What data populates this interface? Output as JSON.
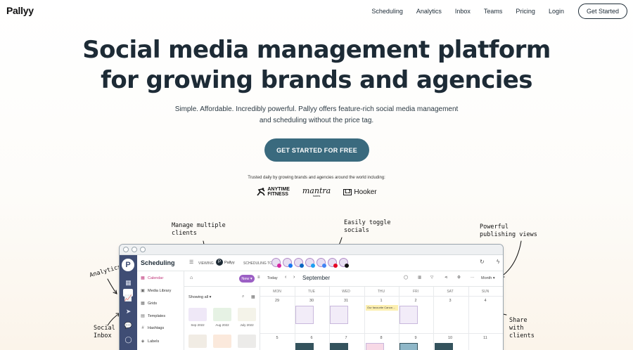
{
  "nav": {
    "logo": "Pallyy",
    "links": [
      "Scheduling",
      "Analytics",
      "Inbox",
      "Teams",
      "Pricing",
      "Login"
    ],
    "cta": "Get Started"
  },
  "hero": {
    "title_line1": "Social media management platform",
    "title_line2": "for growing brands and agencies",
    "subtitle_line1": "Simple. Affordable. Incredibly powerful. Pallyy offers feature-rich social media management",
    "subtitle_line2": "and scheduling without the price tag.",
    "cta": "GET STARTED FOR FREE"
  },
  "trusted": {
    "text": "Trusted daily by growing brands and agencies around the world including:",
    "brands": {
      "anytime_line1": "ANYTIME",
      "anytime_line2": "FITNESS",
      "mantra": "mantra",
      "mantra_sub": "hotels",
      "ljbox": "LJ",
      "lj": "Hooker"
    }
  },
  "annotations": {
    "manage_line1": "Manage multiple",
    "manage_line2": "clients",
    "toggle_line1": "Easily toggle",
    "toggle_line2": "socials",
    "views_line1": "Powerful",
    "views_line2": "publishing views",
    "analytics": "Analytics",
    "inbox_line1": "Social",
    "inbox_line2": "Inbox",
    "share_line1": "Share",
    "share_line2": "with",
    "share_line3": "clients"
  },
  "app": {
    "title": "Scheduling",
    "viewing": "VIEWING",
    "client": "Pallyy",
    "scheduling_to": "SCHEDULING TO",
    "sidebar": [
      "Calendar",
      "Media Library",
      "Grids",
      "Templates",
      "Hashtags",
      "Labels"
    ],
    "new_button": "New",
    "today": "Today",
    "month_name": "September",
    "view_select": "Month",
    "showing": "Showing all",
    "folders": [
      "Sep 2022",
      "Aug 2022",
      "July 2022"
    ],
    "days": [
      "MON",
      "TUE",
      "WED",
      "THU",
      "FRI",
      "SAT",
      "SUN"
    ],
    "week1": [
      "29",
      "30",
      "31",
      "1",
      "2",
      "3",
      "4"
    ],
    "week2": [
      "5",
      "6",
      "7",
      "8",
      "9",
      "10",
      "11"
    ],
    "event": "Our favourite Canva ..."
  },
  "colors": {
    "primary": "#3a6a7e",
    "text": "#1d2b36",
    "rail": "#3f4d74",
    "new_button": "#9b5fc4",
    "active": "#c0377a"
  }
}
